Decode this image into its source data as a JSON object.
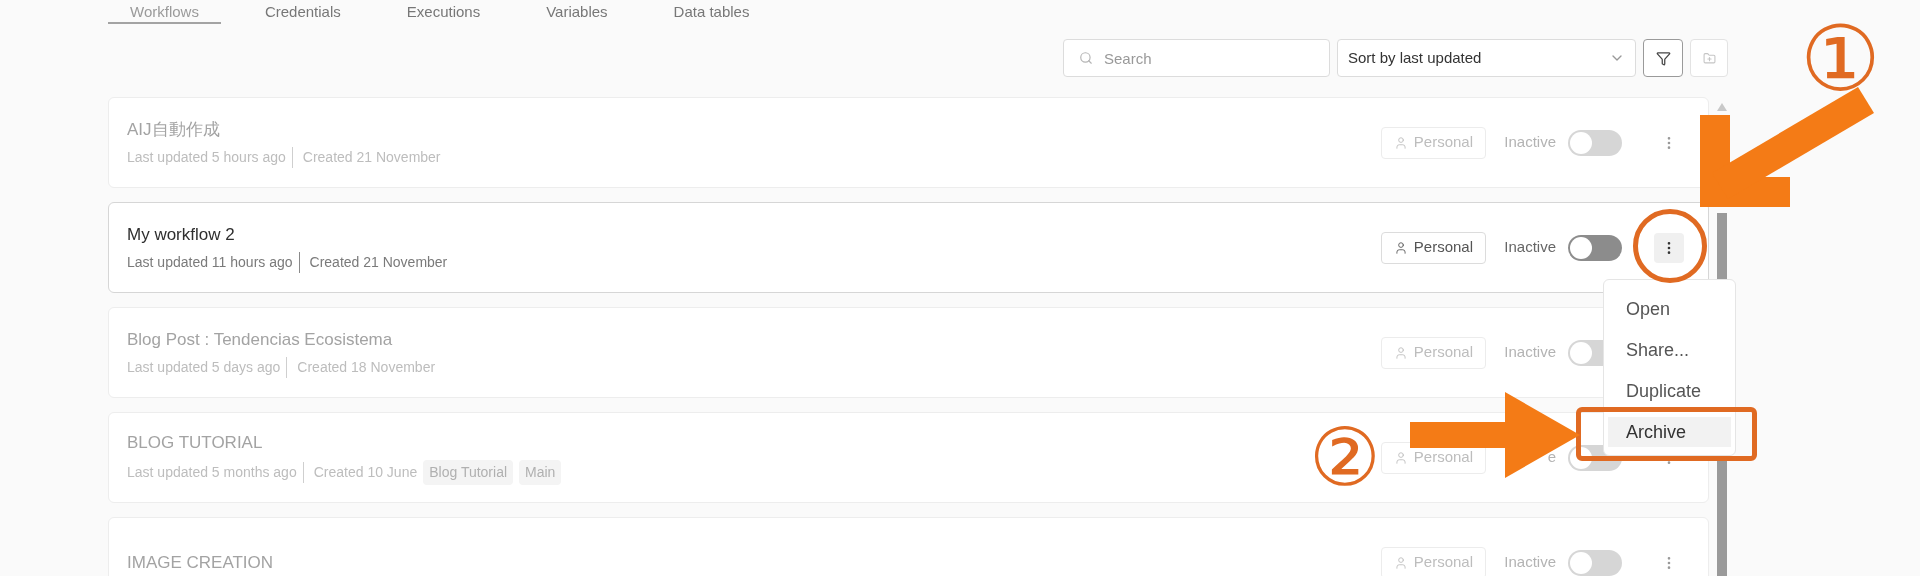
{
  "tabs": [
    {
      "label": "Workflows",
      "selected": true
    },
    {
      "label": "Credentials",
      "selected": false
    },
    {
      "label": "Executions",
      "selected": false
    },
    {
      "label": "Variables",
      "selected": false
    },
    {
      "label": "Data tables",
      "selected": false
    }
  ],
  "toolbar": {
    "search": {
      "placeholder": "Search"
    },
    "sort": {
      "value": "Sort by last updated"
    }
  },
  "workflows": [
    {
      "name": "AIJ自動作成",
      "updated": "Last updated 5 hours ago",
      "created": "Created 21 November",
      "project": "Personal",
      "status": "Inactive",
      "active": false,
      "dimmed": true,
      "menu_open": false
    },
    {
      "name": "My workflow 2",
      "updated": "Last updated 11 hours ago",
      "created": "Created 21 November",
      "project": "Personal",
      "status": "Inactive",
      "active": false,
      "dimmed": false,
      "menu_open": true
    },
    {
      "name": "Blog Post : Tendencias Ecosistema",
      "updated": "Last updated 5 days ago",
      "created": "Created 18 November",
      "project": "Personal",
      "status": "Inactive",
      "active": false,
      "dimmed": true,
      "menu_open": false
    },
    {
      "name": "BLOG TUTORIAL",
      "updated": "Last updated 5 months ago",
      "created": "Created 10 June",
      "tags": [
        "Blog Tutorial",
        "Main"
      ],
      "project": "Personal",
      "status": "e",
      "active": false,
      "dimmed": true,
      "menu_open": false
    },
    {
      "name": "IMAGE CREATION",
      "project": "Personal",
      "status": "Inactive",
      "active": false,
      "dimmed": true,
      "menu_open": false
    }
  ],
  "menu": {
    "items": [
      {
        "label": "Open",
        "selected": false
      },
      {
        "label": "Share...",
        "selected": false
      },
      {
        "label": "Duplicate",
        "selected": false
      },
      {
        "label": "Archive",
        "selected": true
      }
    ]
  },
  "annotations": [
    {
      "label": "①"
    },
    {
      "label": "②"
    }
  ]
}
